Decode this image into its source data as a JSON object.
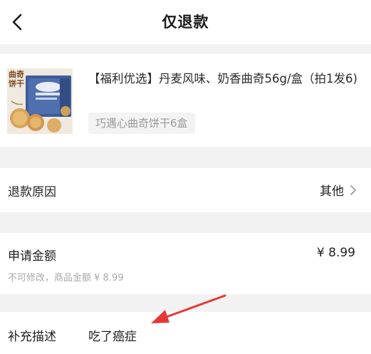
{
  "header": {
    "title": "仅退款",
    "back_icon": "chevron-left-icon"
  },
  "product": {
    "name": "【福利优选】丹麦风味、奶香曲奇56g/盒（拍1发6)",
    "spec": "巧遇心曲奇饼干6盒",
    "thumb_text": "曲奇饼干"
  },
  "refund_reason": {
    "label": "退款原因",
    "value": "其他",
    "chevron_icon": "chevron-right-icon"
  },
  "refund_amount": {
    "label": "申请金额",
    "value": "¥ 8.99",
    "note": "不可修改，商品金额 ¥ 8.99"
  },
  "description": {
    "label": "补充描述",
    "value": "吃了癌症"
  },
  "annotation": {
    "arrow_color": "#e53935"
  }
}
